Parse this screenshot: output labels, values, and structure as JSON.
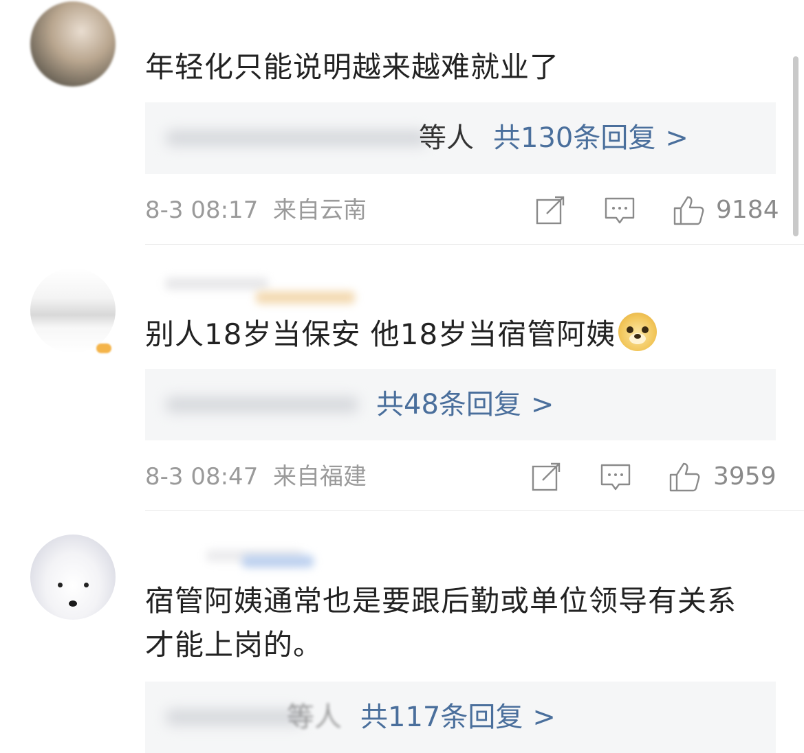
{
  "comments": [
    {
      "text": "年轻化只能说明越来越难就业了",
      "reply_deng": "等人",
      "reply_link": "共130条回复",
      "reply_arrow": ">",
      "time": "8-3 08:17",
      "location": "来自云南",
      "likes": "9184"
    },
    {
      "text": "别人18岁当保安 他18岁当宿管阿姨",
      "emoji": "doge-emoji",
      "reply_link": "共48条回复",
      "reply_arrow": ">",
      "time": "8-3 08:47",
      "location": "来自福建",
      "likes": "3959"
    },
    {
      "text_line1": "宿管阿姨通常也是要跟后勤或单位领导有关系",
      "text_line2": "才能上岗的。",
      "reply_deng": "等人",
      "reply_link": "共117条回复",
      "reply_arrow": ">"
    }
  ],
  "icons": [
    "share-icon",
    "comment-icon",
    "like-icon"
  ],
  "colors": {
    "reply_link": "#4a6f9c",
    "meta_text": "#9a9a9a",
    "reply_bg": "#f5f6f7",
    "body_text": "#222222"
  }
}
